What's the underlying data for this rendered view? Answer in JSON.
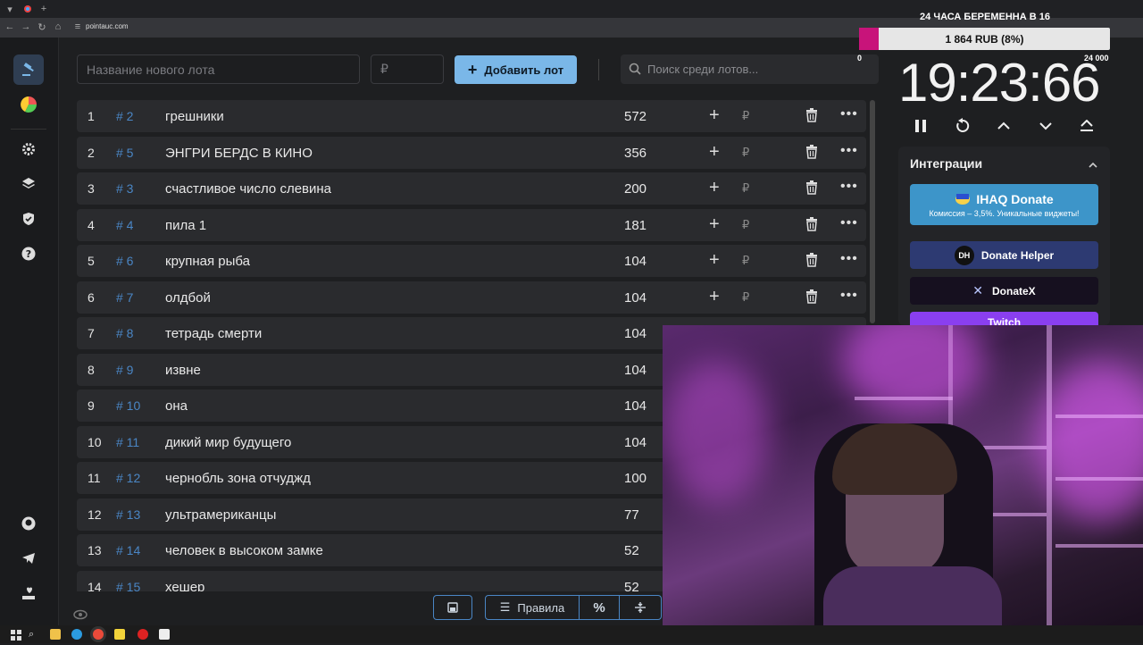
{
  "browser": {
    "url": "pointauc.com"
  },
  "form": {
    "name_placeholder": "Название нового лота",
    "amount_placeholder": "₽",
    "add_label": "Добавить лот",
    "search_placeholder": "Поиск среди лотов..."
  },
  "lots": [
    {
      "num": "1",
      "id": "# 2",
      "name": "грешники",
      "amount": "572"
    },
    {
      "num": "2",
      "id": "# 5",
      "name": "ЭНГРИ БЕРДС В КИНО",
      "amount": "356"
    },
    {
      "num": "3",
      "id": "# 3",
      "name": "счастливое число слевина",
      "amount": "200"
    },
    {
      "num": "4",
      "id": "# 4",
      "name": "пила 1",
      "amount": "181"
    },
    {
      "num": "5",
      "id": "# 6",
      "name": "крупная рыба",
      "amount": "104"
    },
    {
      "num": "6",
      "id": "# 7",
      "name": "олдбой",
      "amount": "104"
    },
    {
      "num": "7",
      "id": "# 8",
      "name": "тетрадь смерти",
      "amount": "104"
    },
    {
      "num": "8",
      "id": "# 9",
      "name": "извне",
      "amount": "104"
    },
    {
      "num": "9",
      "id": "# 10",
      "name": "она",
      "amount": "104"
    },
    {
      "num": "10",
      "id": "# 11",
      "name": "дикий мир будущего",
      "amount": "104"
    },
    {
      "num": "11",
      "id": "# 12",
      "name": "чернобль зона отчуджд",
      "amount": "100"
    },
    {
      "num": "12",
      "id": "# 13",
      "name": "ультрамериканцы",
      "amount": "77"
    },
    {
      "num": "13",
      "id": "# 14",
      "name": "человек в высоком замке",
      "amount": "52"
    },
    {
      "num": "14",
      "id": "# 15",
      "name": "хешер",
      "amount": "52"
    }
  ],
  "lot_rub_symbol": "₽",
  "toolbar": {
    "rules_label": "Правила",
    "percent_label": "%"
  },
  "overlay": {
    "goal_title": "24 ЧАСА БЕРЕМЕННА В 16",
    "goal_progress": "1 864 RUB (8%)",
    "goal_fraction": 0.08,
    "goal_min": "0",
    "goal_max": "24 000",
    "timer": "19:23:66"
  },
  "integrations": {
    "title": "Интеграции",
    "ihaq_title": "IHAQ Donate",
    "ihaq_sub": "Комиссия – 3,5%. Уникальные виджеты!",
    "donate_helper": "Donate Helper",
    "donate_helper_badge": "DH",
    "donatex": "DonateX",
    "twitch": "Twitch"
  },
  "colors": {
    "accent": "#7ab7e8",
    "link": "#4a86c5",
    "goal_fill": "#c8147a",
    "ihaq": "#3d95c9",
    "donate_helper": "#2d3a72",
    "donatex": "#16101f",
    "twitch": "#8a3ff0"
  }
}
